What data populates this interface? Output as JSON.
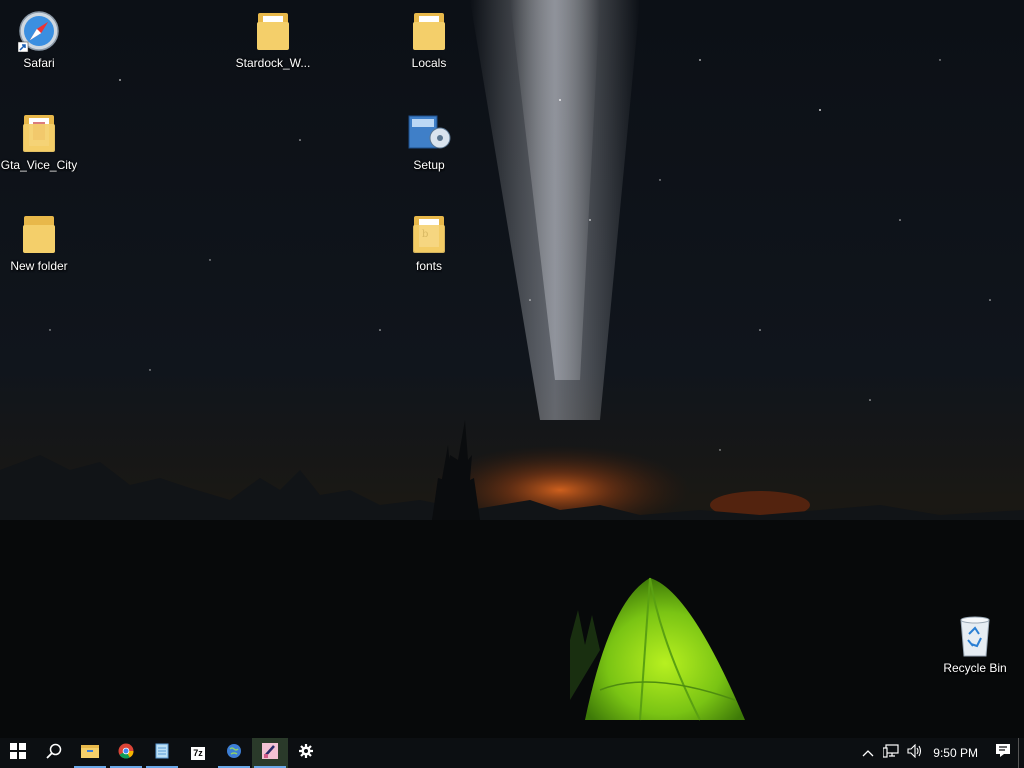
{
  "desktop": {
    "icons": [
      {
        "label": "Safari",
        "icon": "safari-icon"
      },
      {
        "label": "Stardock_W...",
        "icon": "folder-icon"
      },
      {
        "label": "Locals",
        "icon": "folder-icon"
      },
      {
        "label": "Gta_Vice_City",
        "icon": "folder-icon"
      },
      {
        "label": "Setup",
        "icon": "setup-icon"
      },
      {
        "label": "New folder",
        "icon": "folder-icon"
      },
      {
        "label": "fonts",
        "icon": "folder-icon"
      },
      {
        "label": "Recycle Bin",
        "icon": "recycle-bin-icon"
      }
    ]
  },
  "taskbar": {
    "apps": [
      {
        "icon": "start-icon"
      },
      {
        "icon": "search-icon"
      },
      {
        "icon": "file-explorer-icon"
      },
      {
        "icon": "chrome-icon"
      },
      {
        "icon": "notepad-icon"
      },
      {
        "icon": "7zip-icon",
        "text": "7z"
      },
      {
        "icon": "globe-icon"
      },
      {
        "icon": "paint-icon"
      },
      {
        "icon": "settings-icon"
      }
    ],
    "tray": {
      "clock": "9:50 PM"
    }
  }
}
